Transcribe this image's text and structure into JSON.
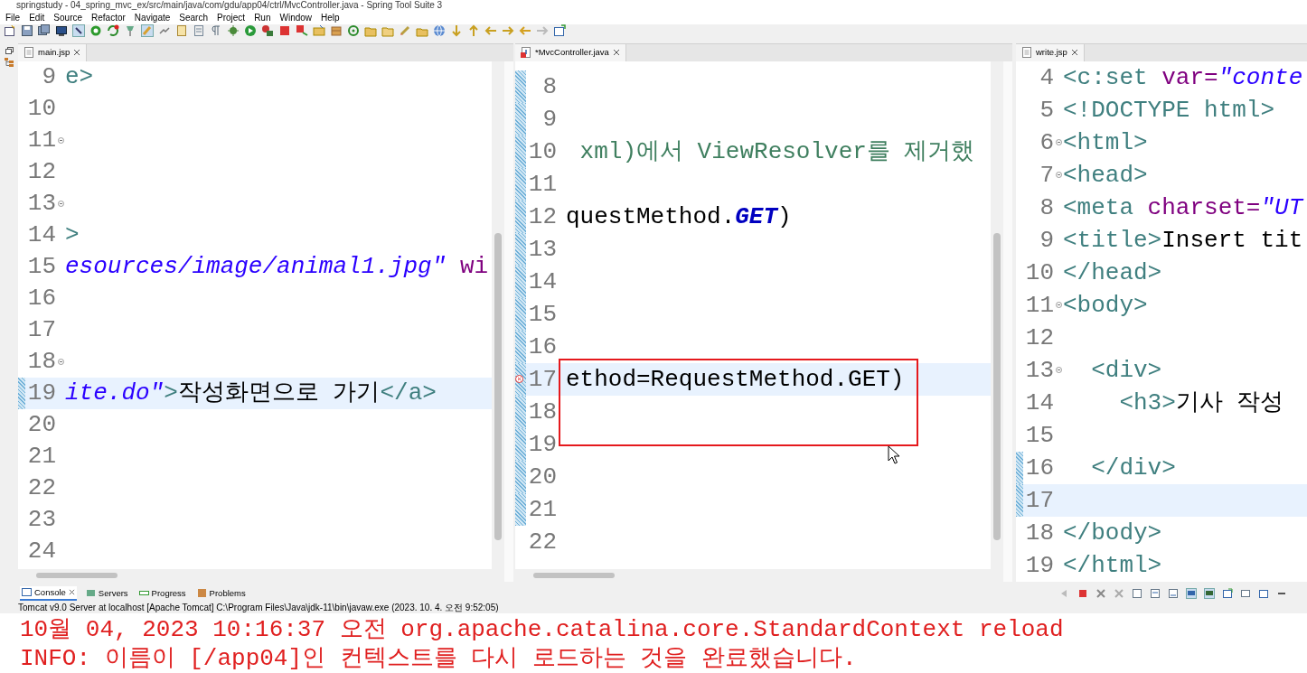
{
  "window": {
    "title": "springstudy - 04_spring_mvc_ex/src/main/java/com/gdu/app04/ctrl/MvcController.java - Spring Tool Suite 3"
  },
  "menu": [
    "File",
    "Edit",
    "Source",
    "Refactor",
    "Navigate",
    "Search",
    "Project",
    "Run",
    "Window",
    "Help"
  ],
  "editors": [
    {
      "tab": {
        "label": "main.jsp",
        "kind": "jsp"
      },
      "lines": [
        {
          "number": "9",
          "tokens": [
            {
              "kind": "tag",
              "text": "e>"
            }
          ],
          "current": false,
          "changed": false,
          "fold": false,
          "error": false
        },
        {
          "number": "10",
          "current": false,
          "changed": false,
          "fold": false,
          "error": false
        },
        {
          "number": "11",
          "current": false,
          "changed": false,
          "fold": true,
          "error": false
        },
        {
          "number": "12",
          "current": false,
          "changed": false,
          "fold": false,
          "error": false
        },
        {
          "number": "13",
          "current": false,
          "changed": false,
          "fold": true,
          "error": false
        },
        {
          "number": "14",
          "tokens": [
            {
              "kind": "tag",
              "text": ">"
            }
          ],
          "current": false,
          "changed": false,
          "fold": false,
          "error": false
        },
        {
          "number": "15",
          "tokens": [
            {
              "kind": "string",
              "text": "esources/image/animal1.jpg\""
            },
            {
              "kind": "attr",
              "text": " wi"
            }
          ],
          "current": false,
          "changed": false,
          "fold": false,
          "error": false
        },
        {
          "number": "16",
          "current": false,
          "changed": false,
          "fold": false,
          "error": false
        },
        {
          "number": "17",
          "current": false,
          "changed": false,
          "fold": false,
          "error": false
        },
        {
          "number": "18",
          "current": false,
          "changed": false,
          "fold": true,
          "error": false
        },
        {
          "number": "19",
          "tokens": [
            {
              "kind": "string",
              "text": "ite.do\""
            },
            {
              "kind": "tag",
              "text": ">"
            },
            {
              "kind": "text",
              "text": "작성화면으로 가기"
            },
            {
              "kind": "tag",
              "text": "</a>"
            }
          ],
          "current": true,
          "changed": true,
          "fold": false,
          "error": false
        },
        {
          "number": "20",
          "current": false,
          "changed": false,
          "fold": false,
          "error": false
        },
        {
          "number": "21",
          "current": false,
          "changed": false,
          "fold": false,
          "error": false
        },
        {
          "number": "22",
          "current": false,
          "changed": false,
          "fold": false,
          "error": false
        },
        {
          "number": "23",
          "current": false,
          "changed": false,
          "fold": false,
          "error": false
        },
        {
          "number": "24",
          "current": false,
          "changed": false,
          "fold": false,
          "error": false
        }
      ]
    },
    {
      "tab": {
        "label": "*MvcController.java",
        "kind": "java"
      },
      "lines": [
        {
          "number": "8",
          "current": false,
          "changed": true,
          "fold": false,
          "error": false
        },
        {
          "number": "9",
          "current": false,
          "changed": true,
          "fold": false,
          "error": false
        },
        {
          "number": "10",
          "tokens": [
            {
              "kind": "comment",
              "text": " xml)에서 ViewResolver를 제거했"
            }
          ],
          "current": false,
          "changed": true,
          "fold": false,
          "error": false
        },
        {
          "number": "11",
          "current": false,
          "changed": true,
          "fold": false,
          "error": false
        },
        {
          "number": "12",
          "tokens": [
            {
              "kind": "text",
              "text": "questMethod."
            },
            {
              "kind": "constant",
              "text": "GET"
            },
            {
              "kind": "text",
              "text": ")"
            }
          ],
          "current": false,
          "changed": true,
          "fold": false,
          "error": false
        },
        {
          "number": "13",
          "current": false,
          "changed": true,
          "fold": false,
          "error": false
        },
        {
          "number": "14",
          "current": false,
          "changed": true,
          "fold": false,
          "error": false
        },
        {
          "number": "15",
          "current": false,
          "changed": true,
          "fold": false,
          "error": false
        },
        {
          "number": "16",
          "current": false,
          "changed": true,
          "fold": false,
          "error": false
        },
        {
          "number": "17",
          "tokens": [
            {
              "kind": "text",
              "text": "ethod=RequestMethod.GET)"
            }
          ],
          "current": true,
          "changed": true,
          "fold": false,
          "error": true
        },
        {
          "number": "18",
          "current": false,
          "changed": true,
          "fold": false,
          "error": false
        },
        {
          "number": "19",
          "current": false,
          "changed": true,
          "fold": false,
          "error": false
        },
        {
          "number": "20",
          "current": false,
          "changed": true,
          "fold": false,
          "error": false
        },
        {
          "number": "21",
          "current": false,
          "changed": true,
          "fold": false,
          "error": false
        },
        {
          "number": "22",
          "current": false,
          "changed": false,
          "fold": false,
          "error": false
        }
      ]
    },
    {
      "tab": {
        "label": "write.jsp",
        "kind": "jsp"
      },
      "lines": [
        {
          "number": "4",
          "tokens": [
            {
              "kind": "tag",
              "text": "<c:set"
            },
            {
              "kind": "attr",
              "text": " var="
            },
            {
              "kind": "string",
              "text": "\"conte"
            }
          ],
          "current": false,
          "changed": false,
          "fold": false,
          "error": false
        },
        {
          "number": "5",
          "tokens": [
            {
              "kind": "tag",
              "text": "<!DOCTYPE html>"
            }
          ],
          "current": false,
          "changed": false,
          "fold": false,
          "error": false
        },
        {
          "number": "6",
          "tokens": [
            {
              "kind": "tag",
              "text": "<html>"
            }
          ],
          "current": false,
          "changed": false,
          "fold": true,
          "error": false
        },
        {
          "number": "7",
          "tokens": [
            {
              "kind": "tag",
              "text": "<head>"
            }
          ],
          "current": false,
          "changed": false,
          "fold": true,
          "error": false
        },
        {
          "number": "8",
          "tokens": [
            {
              "kind": "tag",
              "text": "<meta"
            },
            {
              "kind": "attr",
              "text": " charset="
            },
            {
              "kind": "string",
              "text": "\"UT"
            }
          ],
          "current": false,
          "changed": false,
          "fold": false,
          "error": false
        },
        {
          "number": "9",
          "tokens": [
            {
              "kind": "tag",
              "text": "<title>"
            },
            {
              "kind": "text",
              "text": "Insert tit"
            }
          ],
          "current": false,
          "changed": false,
          "fold": false,
          "error": false
        },
        {
          "number": "10",
          "tokens": [
            {
              "kind": "tag",
              "text": "</head>"
            }
          ],
          "current": false,
          "changed": false,
          "fold": false,
          "error": false
        },
        {
          "number": "11",
          "tokens": [
            {
              "kind": "tag",
              "text": "<body>"
            }
          ],
          "current": false,
          "changed": false,
          "fold": true,
          "error": false
        },
        {
          "number": "12",
          "current": false,
          "changed": false,
          "fold": false,
          "error": false
        },
        {
          "number": "13",
          "tokens": [
            {
              "kind": "tag",
              "text": "  <div>"
            }
          ],
          "current": false,
          "changed": false,
          "fold": true,
          "error": false
        },
        {
          "number": "14",
          "tokens": [
            {
              "kind": "tag",
              "text": "    <h3>"
            },
            {
              "kind": "text",
              "text": "기사 작성"
            }
          ],
          "current": false,
          "changed": false,
          "fold": false,
          "error": false
        },
        {
          "number": "15",
          "current": false,
          "changed": false,
          "fold": false,
          "error": false
        },
        {
          "number": "16",
          "tokens": [
            {
              "kind": "tag",
              "text": "  </div>"
            }
          ],
          "current": false,
          "changed": true,
          "fold": false,
          "error": false
        },
        {
          "number": "17",
          "current": true,
          "changed": true,
          "fold": false,
          "error": false
        },
        {
          "number": "18",
          "tokens": [
            {
              "kind": "tag",
              "text": "</body>"
            }
          ],
          "current": false,
          "changed": false,
          "fold": false,
          "error": false
        },
        {
          "number": "19",
          "tokens": [
            {
              "kind": "tag",
              "text": "</html>"
            }
          ],
          "current": false,
          "changed": false,
          "fold": false,
          "error": false
        }
      ]
    }
  ],
  "console": {
    "tabs": [
      {
        "label": "Console",
        "selected": true
      },
      {
        "label": "Servers",
        "selected": false
      },
      {
        "label": "Progress",
        "selected": false
      },
      {
        "label": "Problems",
        "selected": false
      }
    ],
    "description": "Tomcat v9.0 Server at localhost [Apache Tomcat] C:\\Program Files\\Java\\jdk-11\\bin\\javaw.exe  (2023. 10. 4. 오전 9:52:05)",
    "output": [
      "10월 04, 2023 10:16:37 오전 org.apache.catalina.core.StandardContext reload",
      "INFO: 이름이 [/app04]인 컨텍스트를 다시 로드하는 것을 완료했습니다."
    ]
  }
}
